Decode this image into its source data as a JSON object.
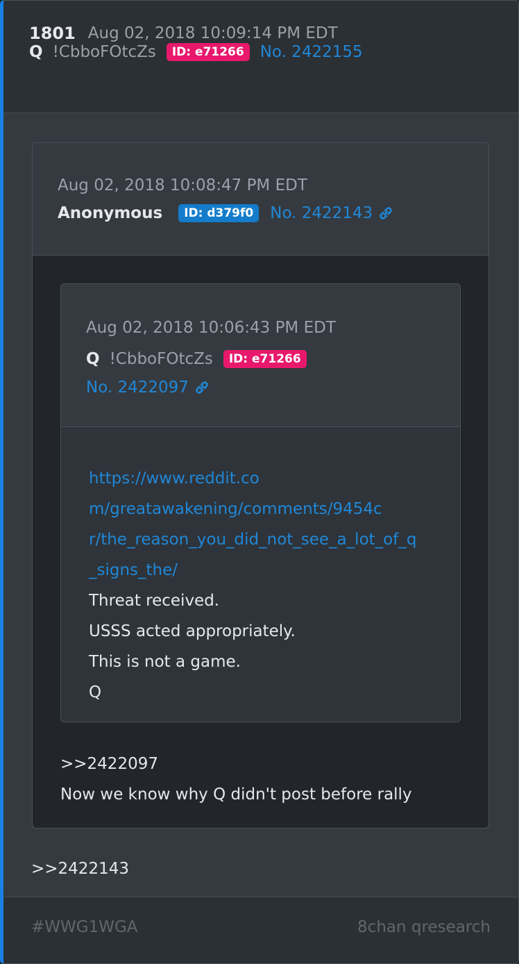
{
  "post": {
    "number": "1801",
    "date": "Aug 02, 2018 10:09:14 PM EDT",
    "name": "Q",
    "tripcode": "!CbboFOtcZs",
    "id_badge": "ID: e71266",
    "post_no": "No. 2422155",
    "reply_ref": ">>2422143"
  },
  "quote": {
    "date": "Aug 02, 2018 10:08:47 PM EDT",
    "name": "Anonymous",
    "id_badge": "ID: d379f0",
    "post_no": "No. 2422143",
    "lines": [
      ">>2422097",
      "Now we know why Q didn't post before rally"
    ]
  },
  "nested_quote": {
    "date": "Aug 02, 2018 10:06:43 PM EDT",
    "name": "Q",
    "tripcode": "!CbboFOtcZs",
    "id_badge": "ID: e71266",
    "post_no": "No. 2422097",
    "url_lines": [
      "https://www.reddit.co",
      "m/greatawakening/comments/9454c",
      "r/the_reason_you_did_not_see_a_lot_of_q",
      "_signs_the/"
    ],
    "lines": [
      "Threat received.",
      "USSS acted appropriately.",
      "This is not a game.",
      "Q"
    ]
  },
  "footer": {
    "hashtag": "#WWG1WGA",
    "source": "8chan qresearch"
  },
  "colors": {
    "accent_bar": "#1a7fe0",
    "badge_q": "#e8196c",
    "badge_anon": "#147ccb",
    "link": "#2187d6"
  }
}
